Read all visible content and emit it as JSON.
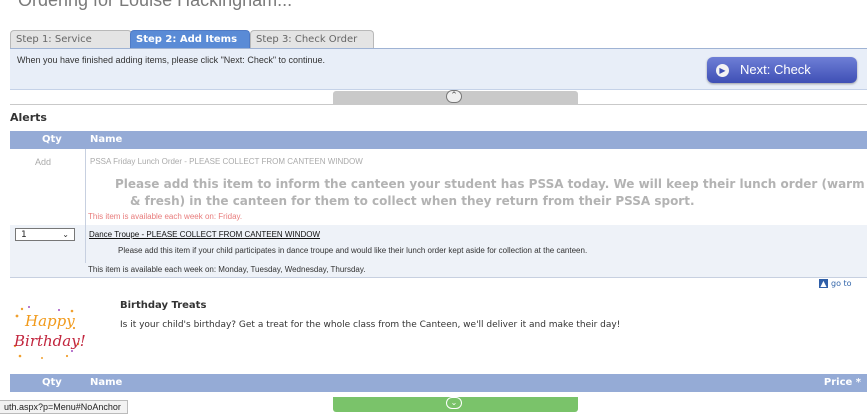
{
  "page": {
    "title": "Ordering for Louise Hackingham..."
  },
  "tabs": [
    {
      "label": "Step 1: Service"
    },
    {
      "label": "Step 2: Add Items"
    },
    {
      "label": "Step 3: Check Order"
    }
  ],
  "instructions": "When you have finished adding items, please click \"Next: Check\" to continue.",
  "next_button": {
    "label": "Next: Check",
    "icon": "chevron-right-icon"
  },
  "alerts": {
    "title": "Alerts",
    "columns": {
      "qty": "Qty",
      "name": "Name"
    },
    "items": [
      {
        "qty_action": "Add",
        "name": "PSSA Friday Lunch Order - PLEASE COLLECT FROM CANTEEN WINDOW",
        "description_line1": "Please add this item to inform the canteen your student has PSSA today. We will keep their lunch order (warm",
        "description_line2": "& fresh) in the canteen for them to collect when they return from their PSSA sport.",
        "availability": "This item is available each week on: Friday.",
        "availability_color": "#e87c7c"
      },
      {
        "qty_selected": "1",
        "name": "Dance Troupe - PLEASE COLLECT FROM CANTEEN WINDOW",
        "description": "Please add this item if your child participates in dance troupe and would like their lunch order kept aside for collection at the canteen.",
        "availability": "This item is available each week on: Monday, Tuesday, Wednesday, Thursday."
      }
    ]
  },
  "goto_link": "go to",
  "birthday": {
    "logo_line1": "Happy",
    "logo_line2": "Birthday!",
    "title": "Birthday Treats",
    "description": "Is it your child's birthday? Get a treat for the whole class from the Canteen, we'll deliver it and make their day!",
    "columns": {
      "qty": "Qty",
      "name": "Name",
      "price": "Price *"
    }
  },
  "status_bar": {
    "url": "uth.aspx?p=Menu#NoAnchor"
  },
  "colors": {
    "header_blue": "#95abd6",
    "tab_active": "#5a8bd6",
    "next_button": "#4f5fc2",
    "expand_green": "#7ac36a"
  }
}
